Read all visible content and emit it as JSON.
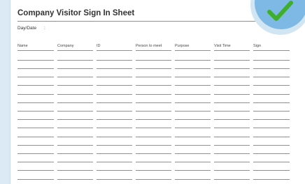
{
  "sheet": {
    "title": "Company Visitor Sign In Sheet",
    "day_date_label": "Day/Date",
    "day_date_separator": ":"
  },
  "columns": [
    {
      "label": "Name"
    },
    {
      "label": "Company"
    },
    {
      "label": "ID"
    },
    {
      "label": "Person to meet"
    },
    {
      "label": "Purpose"
    },
    {
      "label": "Visit Time"
    },
    {
      "label": "Sign"
    }
  ],
  "colors": {
    "background": "#dbeaf5",
    "badge": "#7eb8e4",
    "check": "#3fae2a",
    "rule": "#8f8f8f"
  },
  "icons": {
    "badge_icon": "green-checkmark-icon"
  }
}
